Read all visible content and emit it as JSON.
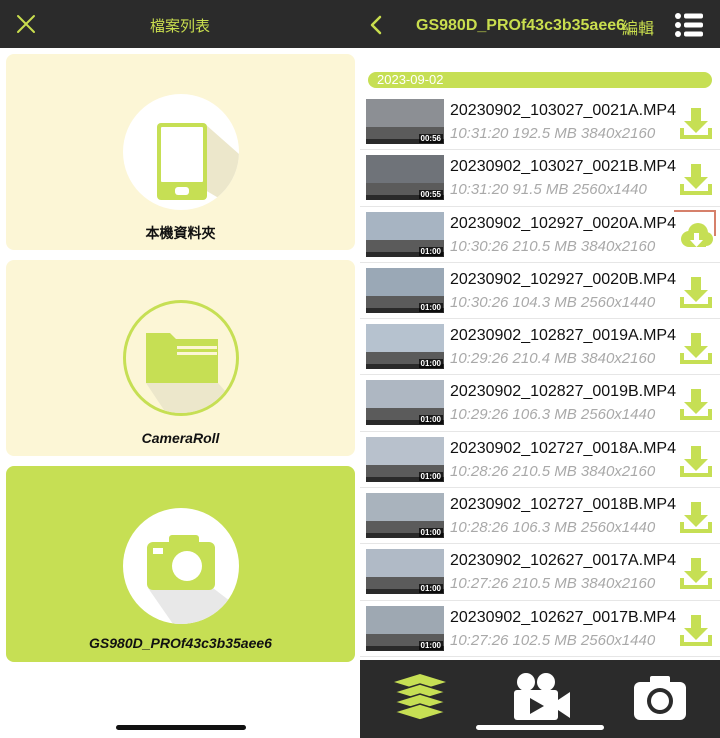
{
  "left": {
    "title": "檔案列表",
    "cards": {
      "local": "本機資料夾",
      "camera_roll": "CameraRoll",
      "device": "GS980D_PROf43c3b35aee6"
    }
  },
  "right": {
    "title": "GS980D_PROf43c3b35aee6",
    "edit_label": "編輯",
    "date_header": "2023-09-02",
    "files": [
      {
        "name": "20230902_103027_0021A.MP4",
        "meta": "10:31:20 192.5 MB 3840x2160",
        "duration": "00:56",
        "status": "download"
      },
      {
        "name": "20230902_103027_0021B.MP4",
        "meta": "10:31:20 91.5 MB 2560x1440",
        "duration": "00:55",
        "status": "download"
      },
      {
        "name": "20230902_102927_0020A.MP4",
        "meta": "10:30:26 210.5 MB 3840x2160",
        "duration": "01:00",
        "status": "downloading"
      },
      {
        "name": "20230902_102927_0020B.MP4",
        "meta": "10:30:26 104.3 MB 2560x1440",
        "duration": "01:00",
        "status": "download"
      },
      {
        "name": "20230902_102827_0019A.MP4",
        "meta": "10:29:26 210.4 MB 3840x2160",
        "duration": "01:00",
        "status": "download"
      },
      {
        "name": "20230902_102827_0019B.MP4",
        "meta": "10:29:26 106.3 MB 2560x1440",
        "duration": "01:00",
        "status": "download"
      },
      {
        "name": "20230902_102727_0018A.MP4",
        "meta": "10:28:26 210.5 MB 3840x2160",
        "duration": "01:00",
        "status": "download"
      },
      {
        "name": "20230902_102727_0018B.MP4",
        "meta": "10:28:26 106.3 MB 2560x1440",
        "duration": "01:00",
        "status": "download"
      },
      {
        "name": "20230902_102627_0017A.MP4",
        "meta": "10:27:26 210.5 MB 3840x2160",
        "duration": "01:00",
        "status": "download"
      },
      {
        "name": "20230902_102627_0017B.MP4",
        "meta": "10:27:26 102.5 MB 2560x1440",
        "duration": "01:00",
        "status": "download"
      }
    ],
    "tabs": [
      "layers-icon",
      "video-camera-icon",
      "camera-icon"
    ]
  },
  "colors": {
    "accent": "#c6df54",
    "header_bg": "#2b2b2b",
    "card_bg": "#fcf6d6",
    "meta_text": "#a9a9a9"
  }
}
